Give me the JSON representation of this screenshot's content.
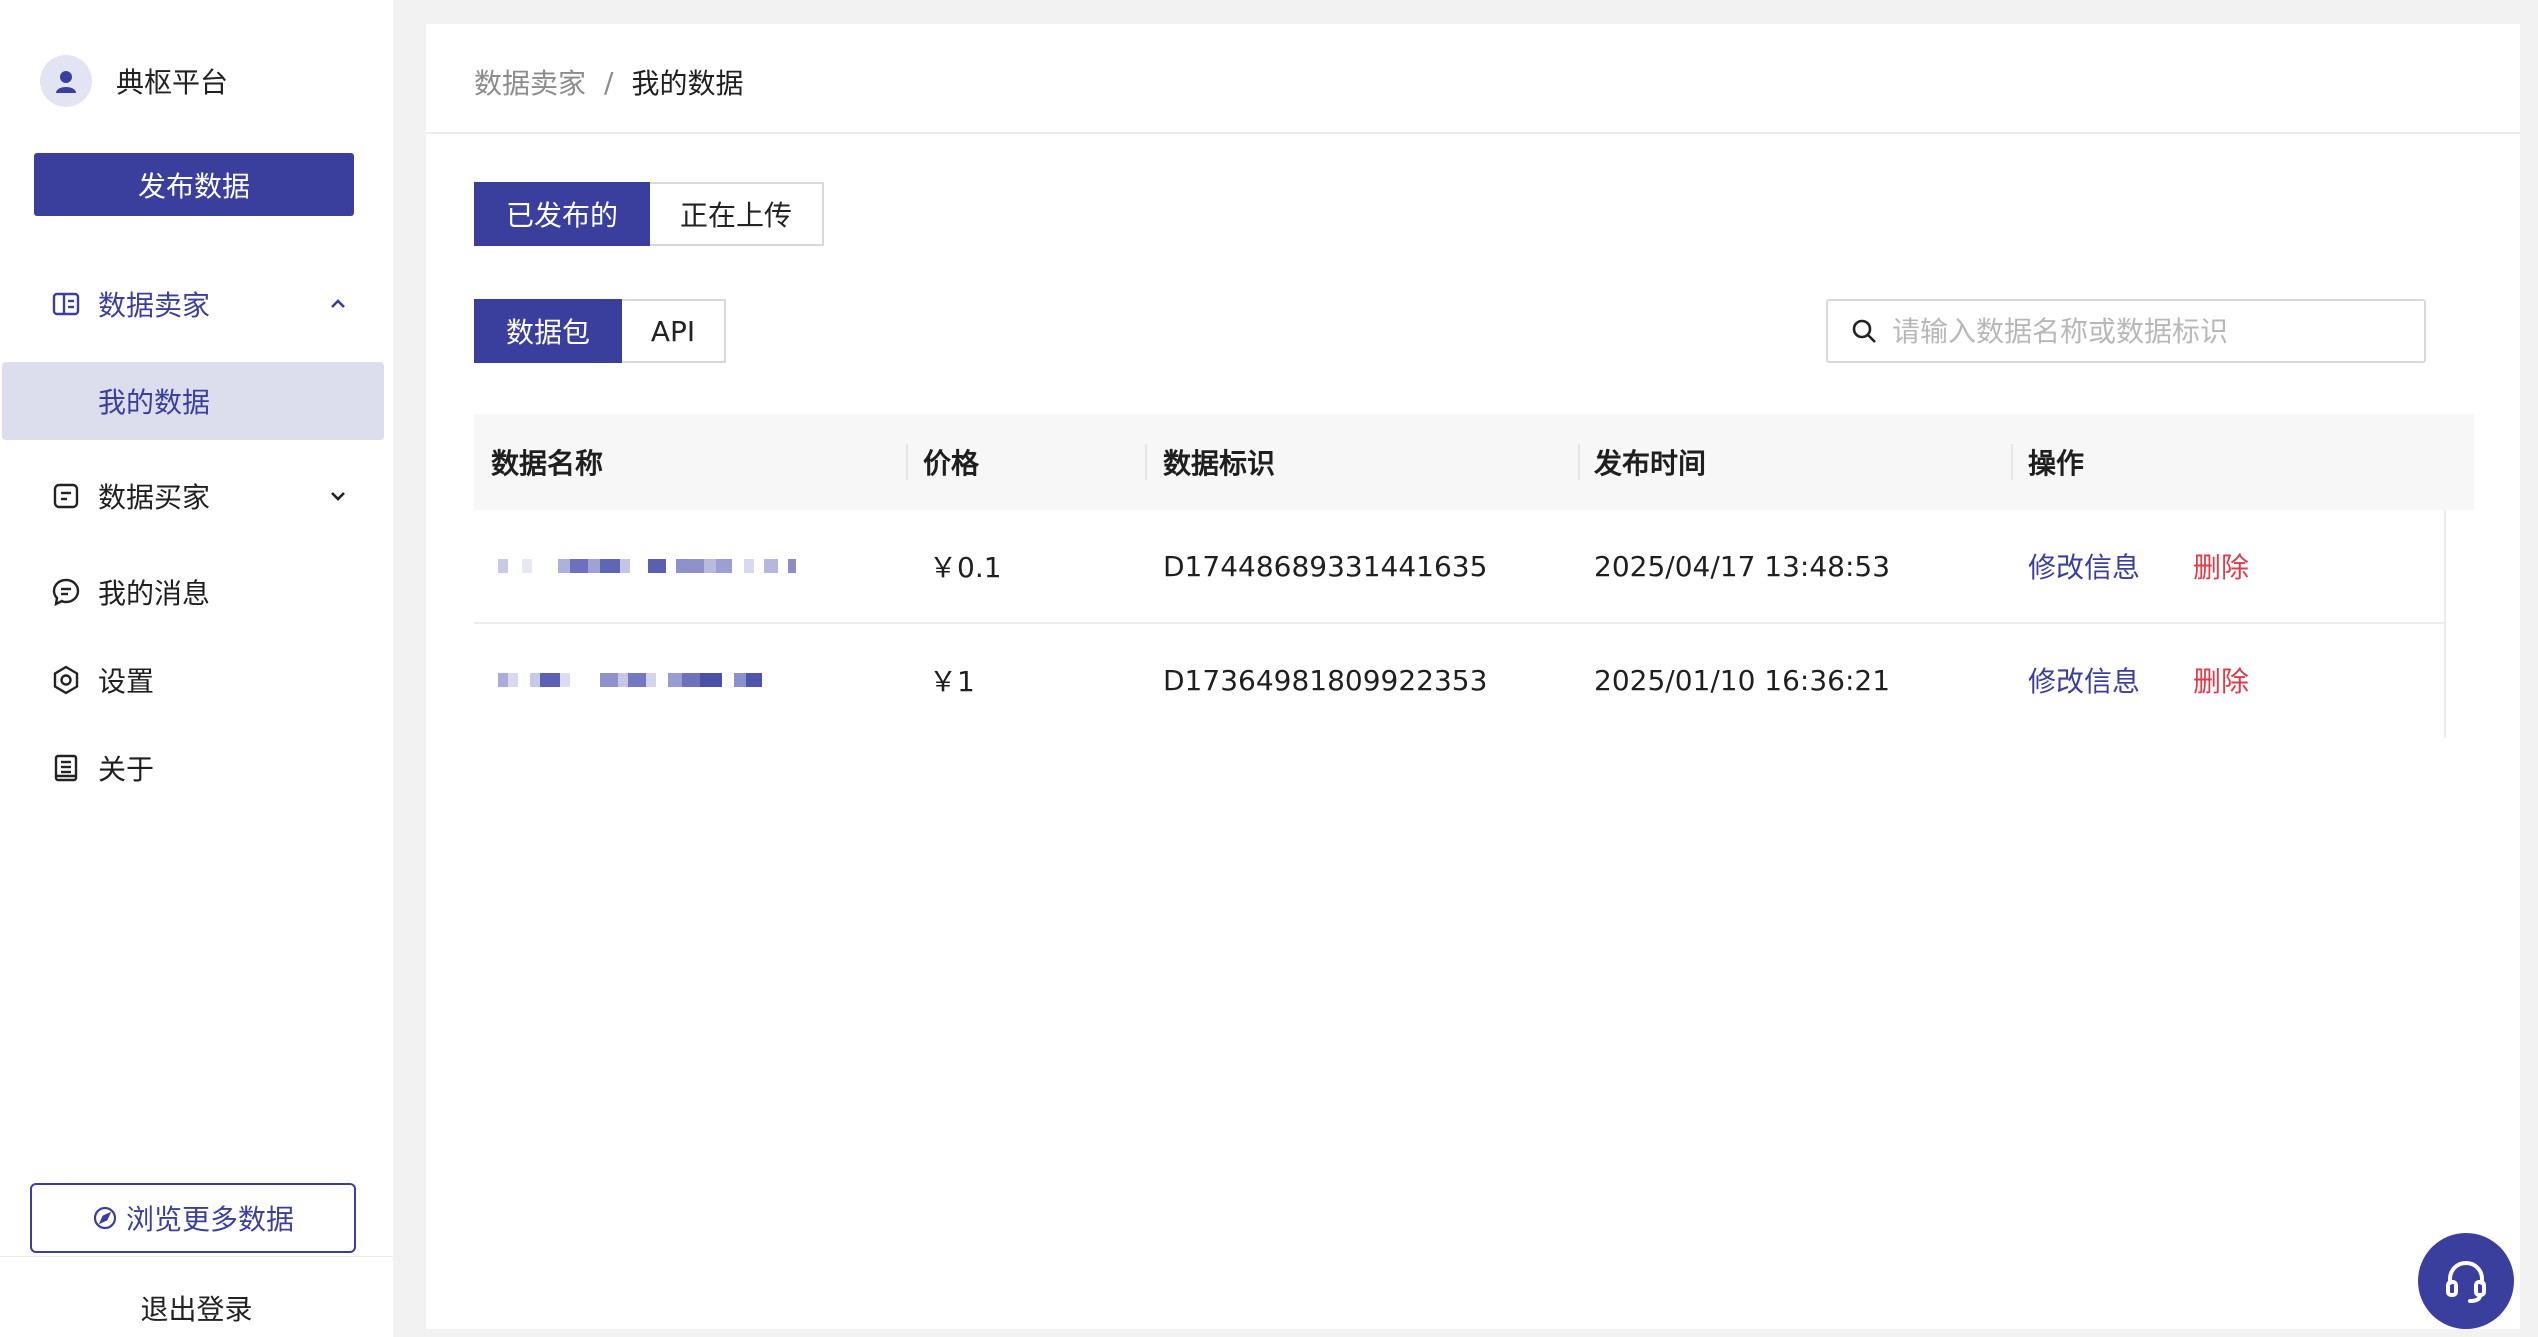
{
  "sidebar": {
    "brand_name": "典枢平台",
    "publish_button": "发布数据",
    "items": [
      {
        "label": "数据卖家",
        "icon": "seller-icon",
        "expanded": true
      },
      {
        "label": "数据买家",
        "icon": "buyer-icon",
        "expanded": false
      },
      {
        "label": "我的消息",
        "icon": "message-icon"
      },
      {
        "label": "设置",
        "icon": "settings-icon"
      },
      {
        "label": "关于",
        "icon": "about-icon"
      }
    ],
    "subitem_active": "我的数据",
    "browse_button": "浏览更多数据",
    "logout": "退出登录"
  },
  "breadcrumb": {
    "parent": "数据卖家",
    "separator": "/",
    "current": "我的数据"
  },
  "status_tabs": [
    {
      "label": "已发布的",
      "active": true
    },
    {
      "label": "正在上传",
      "active": false
    }
  ],
  "type_tabs": [
    {
      "label": "数据包",
      "active": true
    },
    {
      "label": "API",
      "active": false
    }
  ],
  "search": {
    "placeholder": "请输入数据名称或数据标识",
    "value": ""
  },
  "table": {
    "columns": [
      "数据名称",
      "价格",
      "数据标识",
      "发布时间",
      "操作"
    ],
    "rows": [
      {
        "name": "",
        "price": "￥0.1",
        "id": "D17448689331441635",
        "time": "2025/04/17 13:48:53",
        "edit": "修改信息",
        "delete": "删除"
      },
      {
        "name": "",
        "price": "￥1",
        "id": "D17364981809922353",
        "time": "2025/01/10 16:36:21",
        "edit": "修改信息",
        "delete": "删除"
      }
    ]
  },
  "colors": {
    "primary": "#3a3f9e",
    "danger": "#e23a4a",
    "active_bg": "#dcdeee"
  }
}
